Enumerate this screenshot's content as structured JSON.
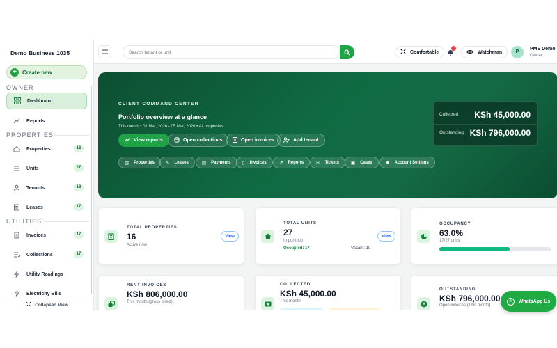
{
  "sidebar": {
    "brand": "Demo Business 1035",
    "create_label": "Create new",
    "sections": {
      "owner": "OWNER",
      "properties": "PROPERTIES",
      "utilities": "UTILITIES"
    },
    "items": [
      {
        "label": "Dashboard",
        "icon": "dashboard-icon",
        "active": true
      },
      {
        "label": "Reports",
        "icon": "reports-icon"
      },
      {
        "label": "Properties",
        "icon": "home-icon",
        "count": "16"
      },
      {
        "label": "Units",
        "icon": "list-icon",
        "count": "27"
      },
      {
        "label": "Tenants",
        "icon": "user-icon",
        "count": "18"
      },
      {
        "label": "Leases",
        "icon": "document-icon",
        "count": "17"
      },
      {
        "label": "Invoices",
        "icon": "invoice-icon",
        "count": "17"
      },
      {
        "label": "Collections",
        "icon": "collections-icon",
        "count": "17"
      },
      {
        "label": "Utility Readings",
        "icon": "bolt-icon"
      },
      {
        "label": "Electricity Bills",
        "icon": "bolt-icon"
      }
    ],
    "collapsed_label": "Collapsed View"
  },
  "topbar": {
    "search_placeholder": "Search tenant or unit",
    "density_label": "Comfortable",
    "watch_label": "Watchman",
    "user_initial": "P",
    "user_name": "PMS Demo",
    "user_role": "Owner"
  },
  "hero": {
    "kicker": "CLIENT COMMAND CENTER",
    "title": "Portfolio overview at a glance",
    "subtitle": "This month • 01 Mar, 2026 - 05 Mar, 2026 • All properties",
    "actions": [
      "View reports",
      "Open collections",
      "Open invoices",
      "Add tenant"
    ],
    "chips": [
      "Properties",
      "Leases",
      "Payments",
      "Invoices",
      "Reports",
      "Tickets",
      "Cases",
      "Account Settings"
    ],
    "collected_label": "Collected",
    "collected_value": "KSh 45,000.00",
    "outstanding_label": "Outstanding",
    "outstanding_value": "KSh 796,000.00"
  },
  "cards": {
    "total_properties": {
      "label": "TOTAL PROPERTIES",
      "value": "16",
      "sub": "Active now",
      "view": "View"
    },
    "total_units": {
      "label": "TOTAL UNITS",
      "value": "27",
      "sub": "In portfolio",
      "occupied": "Occupied: 17",
      "vacant": "Vacant: 10",
      "view": "View"
    },
    "occupancy": {
      "label": "OCCUPANCY",
      "value": "63.0%",
      "sub": "17/27 units",
      "fraction": 0.63
    },
    "rent_invoices": {
      "label": "RENT INVOICES",
      "value": "KSh 806,000.00",
      "sub": "This month (gross billed)."
    },
    "collected": {
      "label": "COLLECTED",
      "value": "KSh 45,000.00",
      "sub": "This month"
    },
    "outstanding": {
      "label": "OUTSTANDING",
      "value": "KSh 796,000.00",
      "sub": "Open invoices (This month)"
    }
  },
  "whatsapp_label": "WhatsApp Us",
  "colors": {
    "accent": "#22a247",
    "hero_dark": "#0d4f33",
    "danger": "#ef4444"
  }
}
